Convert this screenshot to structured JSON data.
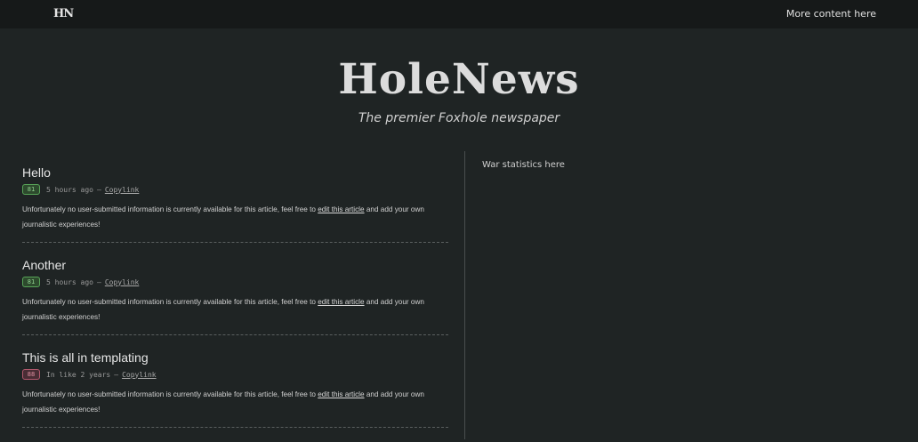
{
  "nav": {
    "logo": "HN",
    "more_link": "More content here"
  },
  "masthead": {
    "title": "HoleNews",
    "tagline": "The premier Foxhole newspaper"
  },
  "articles": [
    {
      "title": "Hello",
      "score": "81",
      "score_status": "positive",
      "time": "5 hours ago",
      "separator": "—",
      "copylink": "Copylink",
      "body_pre": "Unfortunately no user-submitted information is currently available for this article, feel free to",
      "edit_link": "edit this article",
      "body_post": "and add your own journalistic experiences!"
    },
    {
      "title": "Another",
      "score": "81",
      "score_status": "positive",
      "time": "5 hours ago",
      "separator": "—",
      "copylink": "Copylink",
      "body_pre": "Unfortunately no user-submitted information is currently available for this article, feel free to",
      "edit_link": "edit this article",
      "body_post": "and add your own journalistic experiences!"
    },
    {
      "title": "This is all in templating",
      "score": "88",
      "score_status": "negative",
      "time": "In like 2 years",
      "separator": "—",
      "copylink": "Copylink",
      "body_pre": "Unfortunately no user-submitted information is currently available for this article, feel free to",
      "edit_link": "edit this article",
      "body_post": "and add your own journalistic experiences!"
    }
  ],
  "sidebar": {
    "text": "War statistics here"
  },
  "colors": {
    "background": "#1f2424",
    "topbar": "#161919",
    "score_positive": "#58a458",
    "score_negative": "#b2586d"
  }
}
